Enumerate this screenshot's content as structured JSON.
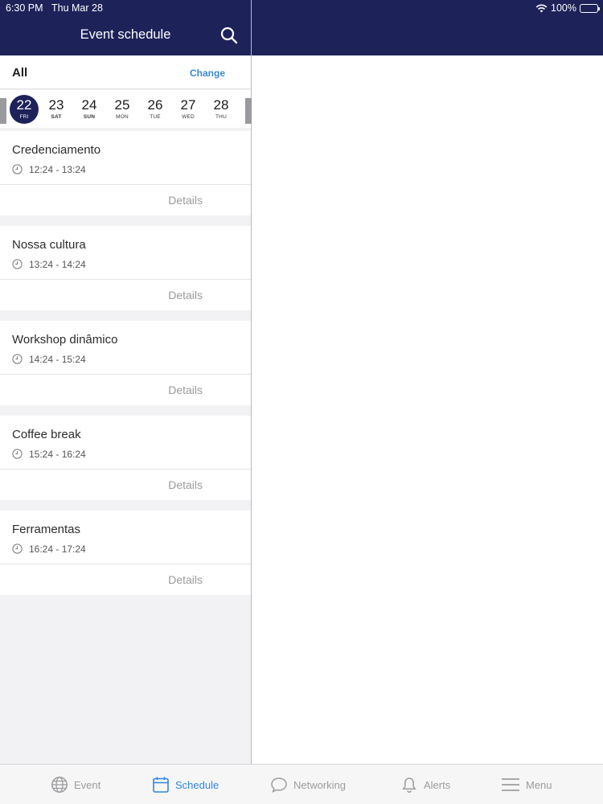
{
  "status_bar": {
    "time": "6:30 PM",
    "date": "Thu Mar 28",
    "battery": "100%"
  },
  "header": {
    "title": "Event schedule",
    "search_icon": "search-icon"
  },
  "filter": {
    "label": "All",
    "change": "Change"
  },
  "days": [
    {
      "num": "22",
      "wk": "FRI",
      "selected": true
    },
    {
      "num": "23",
      "wk": "SAT",
      "selected": false
    },
    {
      "num": "24",
      "wk": "SUN",
      "selected": false
    },
    {
      "num": "25",
      "wk": "MON",
      "selected": false
    },
    {
      "num": "26",
      "wk": "TUE",
      "selected": false
    },
    {
      "num": "27",
      "wk": "WED",
      "selected": false
    },
    {
      "num": "28",
      "wk": "THU",
      "selected": false
    }
  ],
  "events": [
    {
      "title": "Credenciamento",
      "time": "12:24 - 13:24",
      "details": "Details"
    },
    {
      "title": "Nossa cultura",
      "time": "13:24 - 14:24",
      "details": "Details"
    },
    {
      "title": "Workshop dinâmico",
      "time": "14:24 - 15:24",
      "details": "Details"
    },
    {
      "title": "Coffee break",
      "time": "15:24 - 16:24",
      "details": "Details"
    },
    {
      "title": "Ferramentas",
      "time": "16:24 - 17:24",
      "details": "Details"
    }
  ],
  "tabs": [
    {
      "label": "Event",
      "icon": "globe-icon",
      "active": false
    },
    {
      "label": "Schedule",
      "icon": "calendar-icon",
      "active": true
    },
    {
      "label": "Networking",
      "icon": "chat-bubble-icon",
      "active": false
    },
    {
      "label": "Alerts",
      "icon": "bell-icon",
      "active": false
    },
    {
      "label": "Menu",
      "icon": "menu-icon",
      "active": false
    }
  ],
  "colors": {
    "navy": "#1d2259",
    "accent": "#2f86e0",
    "link": "#3b88d6"
  }
}
